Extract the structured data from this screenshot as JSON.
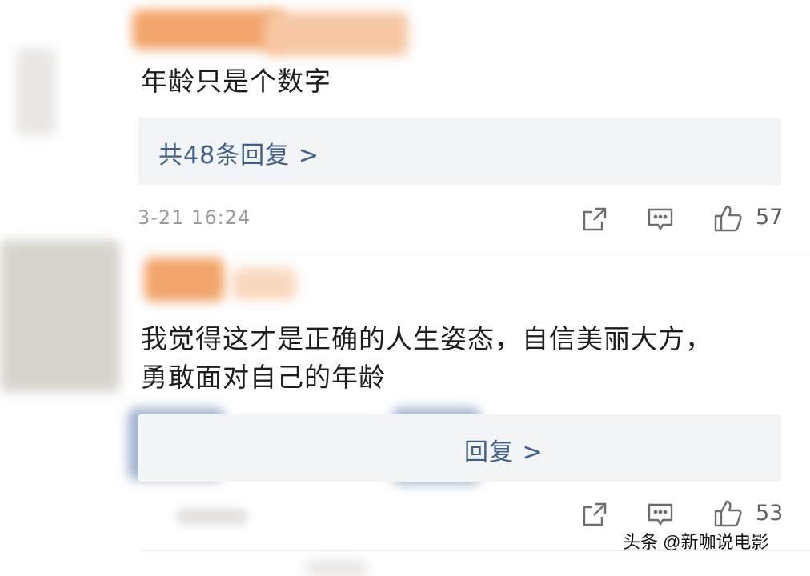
{
  "comments": [
    {
      "text": "年龄只是个数字",
      "reply_link": "共48条回复 >",
      "time": "3-21 16:24",
      "likes": "57",
      "icons": [
        "share-icon",
        "comment-icon",
        "like-icon"
      ]
    },
    {
      "text_line1": "我觉得这才是正确的人生姿态，自信美丽大方，",
      "text_line2": "勇敢面对自己的年龄",
      "reply_link": "回复 >",
      "likes": "53",
      "icons": [
        "share-icon",
        "comment-icon",
        "like-icon"
      ]
    }
  ],
  "watermark": "头条 @新咖说电影",
  "colors": {
    "reply_link": "#3e5f87",
    "reply_bg": "#f3f4f6",
    "timestamp": "#9b9b9b"
  }
}
